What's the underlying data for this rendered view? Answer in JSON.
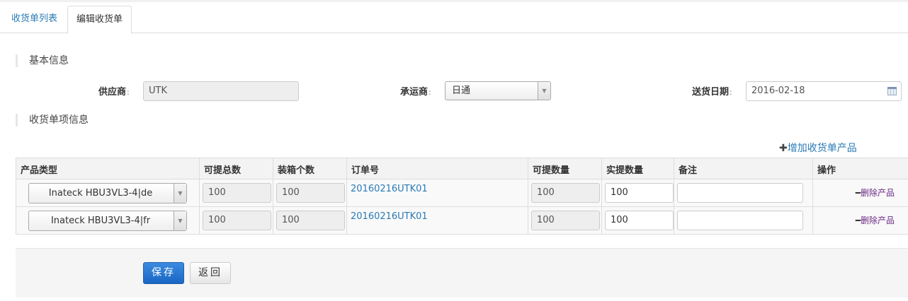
{
  "tabs": {
    "list": "收货单列表",
    "edit": "编辑收货单"
  },
  "basic": {
    "section_title": "基本信息",
    "supplier": {
      "label": "供应商",
      "value": "UTK"
    },
    "carrier": {
      "label": "承运商",
      "value": "日通"
    },
    "delivery_date": {
      "label": "送货日期",
      "value": "2016-02-18"
    }
  },
  "items": {
    "section_title": "收货单项信息",
    "add_label": "增加收货单产品",
    "columns": [
      "产品类型",
      "可提总数",
      "装箱个数",
      "订单号",
      "可提数量",
      "实提数量",
      "备注",
      "操作"
    ],
    "rows": [
      {
        "product": "Inateck HBU3VL3-4|de",
        "total": "100",
        "per_box": "100",
        "order_no": "20160216UTK01",
        "available": "100",
        "actual": "100",
        "note": "",
        "delete": "删除产品"
      },
      {
        "product": "Inateck HBU3VL3-4|fr",
        "total": "100",
        "per_box": "100",
        "order_no": "20160216UTK01",
        "available": "100",
        "actual": "100",
        "note": "",
        "delete": "删除产品"
      }
    ]
  },
  "actions": {
    "save": "保存",
    "back": "返回"
  },
  "colors": {
    "link": "#2a7ab5",
    "primary_button": "#1a66c4",
    "delete_link": "#6b2a84"
  }
}
